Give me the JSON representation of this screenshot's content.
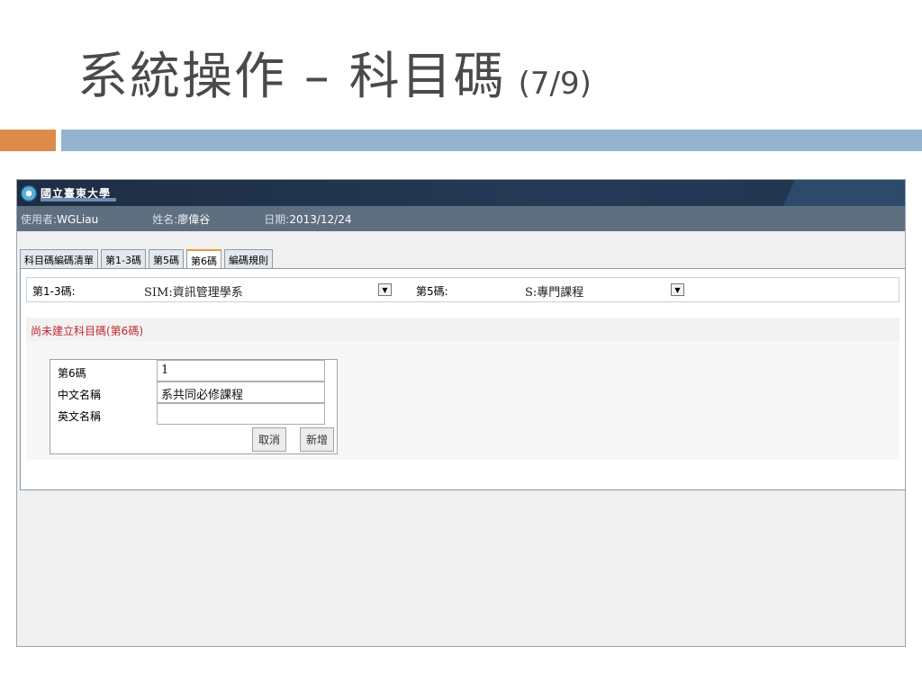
{
  "slide": {
    "title": "系統操作 – 科目碼",
    "page_indicator": "(7/9)"
  },
  "app": {
    "logo_text": "國立臺東大學",
    "user_bar": {
      "user_label": "使用者:",
      "user_value": "WGLiau",
      "name_label": "姓名:",
      "name_value": "廖偉谷",
      "date_label": "日期:",
      "date_value": "2013/12/24"
    },
    "tabs": [
      {
        "label": "科目碼編碼清單",
        "active": false
      },
      {
        "label": "第1-3碼",
        "active": false
      },
      {
        "label": "第5碼",
        "active": false
      },
      {
        "label": "第6碼",
        "active": true
      },
      {
        "label": "編碼規則",
        "active": false
      }
    ],
    "filters": {
      "code13_label": "第1-3碼:",
      "code13_value": "SIM:資訊管理學系",
      "code5_label": "第5碼:",
      "code5_value": "S:專門課程"
    },
    "notice": "尚未建立科目碼(第6碼)",
    "form": {
      "code6_label": "第6碼",
      "code6_value": "1",
      "zh_name_label": "中文名稱",
      "zh_name_value": "系共同必修課程",
      "en_name_label": "英文名稱",
      "en_name_value": "",
      "cancel_label": "取消",
      "add_label": "新增"
    }
  },
  "colors": {
    "accent_orange": "#de8a4a",
    "accent_blue": "#94b3cf",
    "notice_red": "#c0282d"
  }
}
